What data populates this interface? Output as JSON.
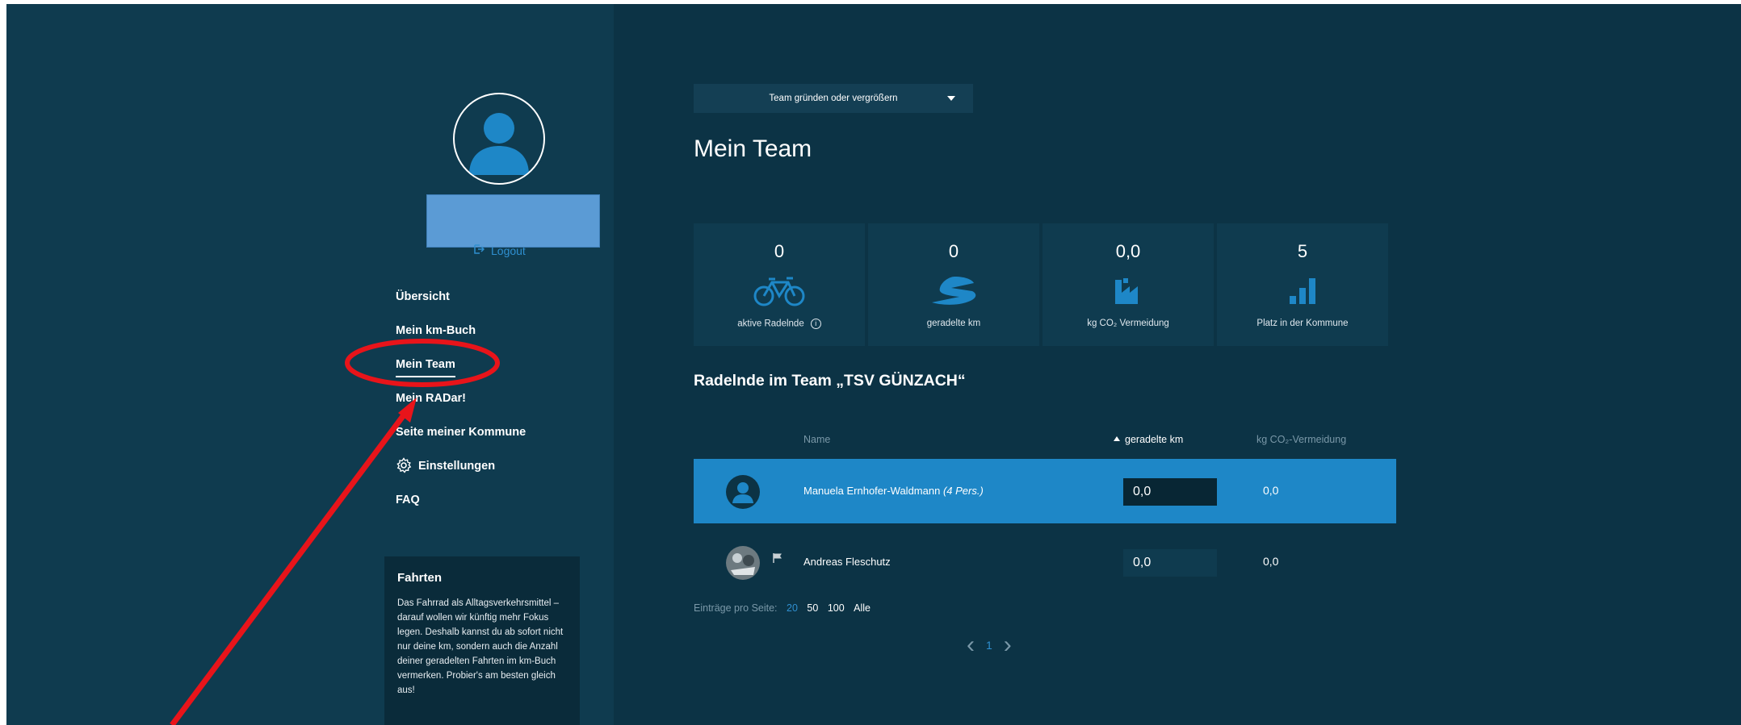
{
  "sidebar": {
    "logout_label": "Logout",
    "nav_items": [
      {
        "label": "Übersicht"
      },
      {
        "label": "Mein km-Buch"
      },
      {
        "label": "Mein Team"
      },
      {
        "label": "Mein RADar!"
      },
      {
        "label": "Seite meiner Kommune"
      },
      {
        "label": "Einstellungen"
      },
      {
        "label": "FAQ"
      }
    ],
    "fahrten": {
      "title": "Fahrten",
      "text": "Das Fahrrad als Alltagsverkehrsmittel – darauf wollen wir künftig mehr Fokus legen. Deshalb kannst du ab sofort nicht nur deine km, sondern auch die Anzahl deiner geradelten Fahrten im km-Buch vermerken. Probier's am besten gleich aus!"
    }
  },
  "main": {
    "dropdown_label": "Team gründen oder vergrößern",
    "page_title": "Mein Team",
    "stats": [
      {
        "value": "0",
        "label": "aktive Radelnde",
        "icon": "bicycle-icon"
      },
      {
        "value": "0",
        "label": "geradelte km",
        "icon": "road-icon"
      },
      {
        "value": "0,0",
        "label": "kg CO₂ Vermeidung",
        "icon": "factory-icon"
      },
      {
        "value": "5",
        "label": "Platz in der Kommune",
        "icon": "bar-chart-icon"
      }
    ],
    "section_title": "Radelnde im Team „TSV GÜNZACH“",
    "table": {
      "col_name": "Name",
      "col_km": "geradelte km",
      "col_co2": "kg CO₂-Vermeidung",
      "rows": [
        {
          "name": "Manuela Ernhofer-Waldmann",
          "persons": "(4 Pers.)",
          "km": "0,0",
          "co2": "0,0"
        },
        {
          "name": "Andreas Fleschutz",
          "persons": "",
          "km": "0,0",
          "co2": "0,0"
        }
      ]
    },
    "per_page": {
      "label": "Einträge pro Seite:",
      "options": [
        "20",
        "50",
        "100",
        "Alle"
      ]
    },
    "pagination": {
      "current_page": "1"
    }
  },
  "colors": {
    "background": "#0c3345",
    "sidebar": "#0f3b4f",
    "accent_blue": "#1e87c7",
    "link_blue": "#2f8fd0",
    "annotation_red": "#e8141a"
  }
}
